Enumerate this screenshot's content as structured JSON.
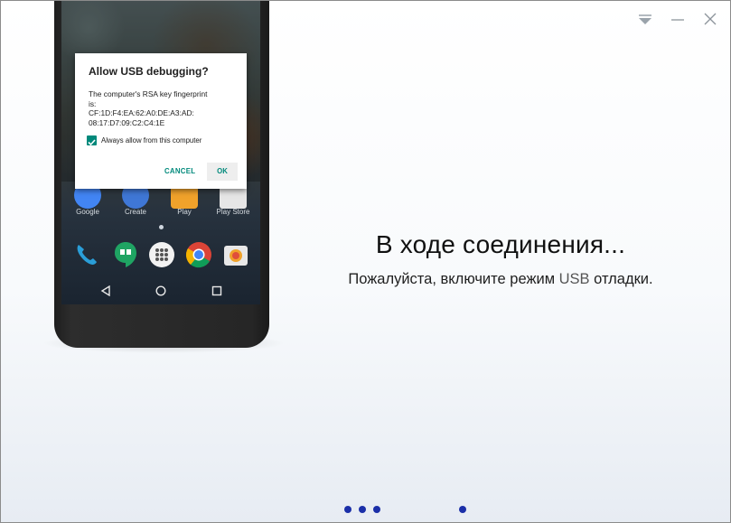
{
  "window": {
    "controls": [
      "dropdown-menu",
      "minimize",
      "close"
    ]
  },
  "phone": {
    "home_apps": [
      {
        "label": "Google",
        "color": "#4285f4"
      },
      {
        "label": "Create",
        "color": "#3f77d6"
      },
      {
        "label": "Play",
        "color": "#f0a22b"
      },
      {
        "label": "Play Store",
        "color": "#e6e6e6"
      }
    ],
    "dock_apps": [
      {
        "name": "phone-icon",
        "color": "#2a9ed8"
      },
      {
        "name": "hangouts-icon",
        "color": "#1fa463"
      },
      {
        "name": "apps-icon",
        "color": "#f2f2f2"
      },
      {
        "name": "chrome-icon",
        "color": "#db4437"
      },
      {
        "name": "camera-icon",
        "color": "#e8e8e8"
      }
    ]
  },
  "dialog": {
    "title": "Allow USB debugging?",
    "body_line1": "The computer's RSA key fingerprint",
    "body_line2": "is:",
    "body_line3": "CF:1D:F4:EA:62:A0:DE:A3:AD:",
    "body_line4": "08:17:D7:09:C2:C4:1E",
    "checkbox_label": "Always allow from this computer",
    "checkbox_checked": true,
    "cancel_label": "CANCEL",
    "ok_label": "OK",
    "accent_color": "#00897b"
  },
  "status": {
    "title": "В ходе соединения...",
    "subtitle_before": "Пожалуйста, включите режим ",
    "subtitle_usb": "USB",
    "subtitle_after": " отладки."
  },
  "progress": {
    "dot_color": "#1b2fa8"
  }
}
